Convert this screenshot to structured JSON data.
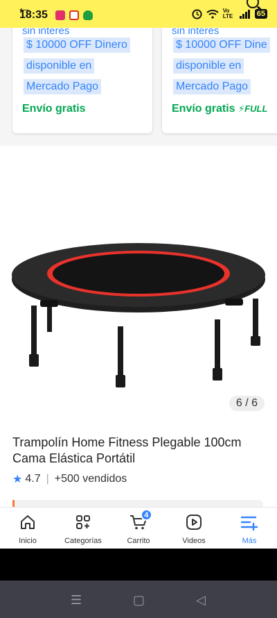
{
  "status_bar": {
    "time": "18:35",
    "battery": "65",
    "network_label": "Vo LTE"
  },
  "cards": [
    {
      "subtitle": "sin interés",
      "promo_lines": [
        "$ 10000 OFF Dinero",
        "disponible en",
        "Mercado Pago"
      ],
      "shipping": "Envío gratis",
      "full_badge": ""
    },
    {
      "subtitle": "sin interés",
      "promo_lines": [
        "$ 10000 OFF Dine",
        "disponible en",
        "Mercado Pago"
      ],
      "shipping": "Envío gratis",
      "full_badge": "FULL"
    }
  ],
  "product": {
    "image_counter": "6 / 6",
    "title": "Trampolín Home Fitness Plegable 100cm Cama Elástica Portátil",
    "rating": "4.7",
    "sold": "+500 vendidos"
  },
  "bottom_nav": {
    "items": [
      {
        "label": "Inicio",
        "icon": "home-icon"
      },
      {
        "label": "Categorías",
        "icon": "categories-icon"
      },
      {
        "label": "Carrito",
        "icon": "cart-icon",
        "badge": "4"
      },
      {
        "label": "Videos",
        "icon": "video-icon"
      },
      {
        "label": "Más",
        "icon": "menu-plus-icon",
        "active": true
      }
    ]
  },
  "colors": {
    "brand_yellow": "#fff159",
    "accent_blue": "#3483fa",
    "shipping_green": "#00a650"
  }
}
